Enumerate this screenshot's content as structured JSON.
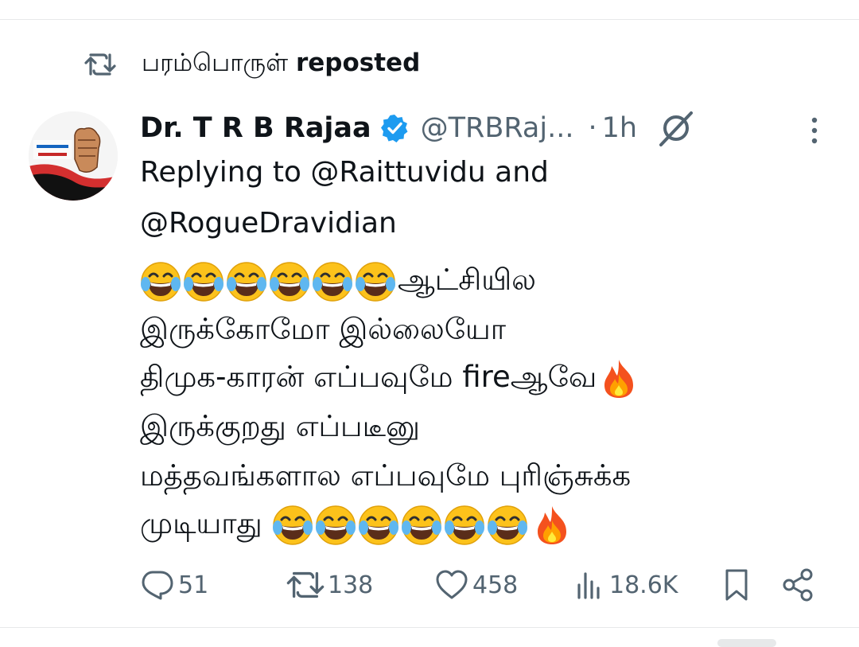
{
  "repost": {
    "reposter_name": "பரம்பொருள்",
    "label": "reposted"
  },
  "post": {
    "author_name": "Dr. T R B Rajaa",
    "handle": "@TRBRaj...",
    "separator": "·",
    "time": "1h",
    "reply_line_1": "Replying to @Raittuvidu and",
    "reply_line_2": "@RogueDravidian",
    "text_line_1": "ஆட்சியில",
    "text_line_2": "இருக்கோமோ இல்லையோ",
    "text_line_3": "திமுக-காரன் எப்பவுமே fireஆவே",
    "text_line_4": "இருக்குறது எப்படீனு",
    "text_line_5": "மத்தவங்களால எப்பவுமே புரிஞ்சுக்க",
    "text_line_6": "முடியாது"
  },
  "actions": {
    "replies": "51",
    "reposts": "138",
    "likes": "458",
    "views": "18.6K"
  },
  "icons": {
    "repost": "repost-icon",
    "verified": "verified-badge-icon",
    "grok": "grok-icon",
    "more": "more-vertical-icon",
    "reply": "reply-icon",
    "like": "heart-icon",
    "views": "views-icon",
    "bookmark": "bookmark-icon",
    "share": "share-icon",
    "laugh_emoji": "tears-of-joy-emoji",
    "fire_emoji": "fire-emoji"
  },
  "colors": {
    "text_primary": "#0f1419",
    "text_secondary": "#536471",
    "verified_blue": "#1d9bf0"
  }
}
